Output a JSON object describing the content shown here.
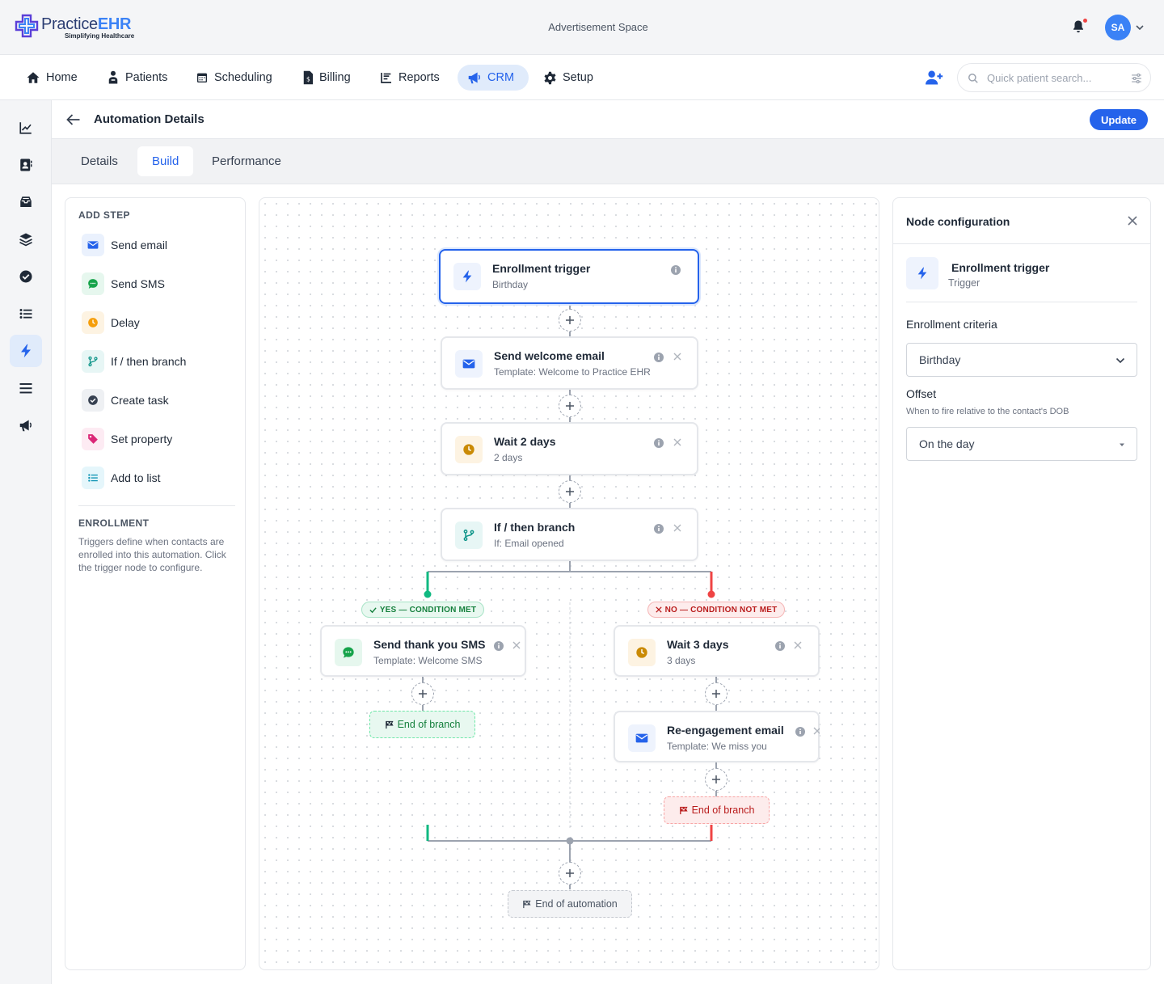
{
  "header": {
    "logo_main": "Practice",
    "logo_accent": "EHR",
    "logo_tagline": "Simplifying Healthcare",
    "ad_space": "Advertisement Space",
    "user_initials": "SA"
  },
  "nav": {
    "items": [
      {
        "label": "Home",
        "icon": "home-icon"
      },
      {
        "label": "Patients",
        "icon": "patient-icon"
      },
      {
        "label": "Scheduling",
        "icon": "calendar-icon"
      },
      {
        "label": "Billing",
        "icon": "billing-icon"
      },
      {
        "label": "Reports",
        "icon": "reports-icon"
      },
      {
        "label": "CRM",
        "icon": "megaphone-icon",
        "active": true
      },
      {
        "label": "Setup",
        "icon": "gear-icon"
      }
    ],
    "search_placeholder": "Quick patient search..."
  },
  "rail": {
    "icons": [
      "chart-line-icon",
      "contacts-icon",
      "inbox-icon",
      "layers-icon",
      "check-circle-icon",
      "list-icon",
      "bolt-icon",
      "menu-lines-icon",
      "megaphone-icon"
    ],
    "active_index": 6
  },
  "page": {
    "title": "Automation Details",
    "update_label": "Update",
    "tabs": [
      {
        "label": "Details"
      },
      {
        "label": "Build",
        "active": true
      },
      {
        "label": "Performance"
      }
    ]
  },
  "add_step": {
    "title": "ADD STEP",
    "items": [
      {
        "label": "Send email",
        "icon": "mail-icon"
      },
      {
        "label": "Send SMS",
        "icon": "sms-icon"
      },
      {
        "label": "Delay",
        "icon": "clock-icon"
      },
      {
        "label": "If / then branch",
        "icon": "branch-icon"
      },
      {
        "label": "Create task",
        "icon": "check-circle-icon"
      },
      {
        "label": "Set property",
        "icon": "tag-icon"
      },
      {
        "label": "Add to list",
        "icon": "list-icon"
      }
    ],
    "enrollment_title": "ENROLLMENT",
    "enrollment_text": "Triggers define when contacts are enrolled into this automation. Click the trigger node to configure."
  },
  "flow": {
    "trigger": {
      "title": "Enrollment trigger",
      "subtitle": "Birthday"
    },
    "welcome": {
      "title": "Send welcome email",
      "subtitle": "Template: Welcome to Practice EHR"
    },
    "wait2": {
      "title": "Wait 2 days",
      "subtitle": "2 days"
    },
    "branch": {
      "title": "If / then branch",
      "subtitle": "If: Email opened"
    },
    "yes_label": "YES — CONDITION MET",
    "no_label": "NO — CONDITION NOT MET",
    "thank_sms": {
      "title": "Send thank you SMS",
      "subtitle": "Template: Welcome SMS"
    },
    "wait3": {
      "title": "Wait 3 days",
      "subtitle": "3 days"
    },
    "reengage": {
      "title": "Re-engagement email",
      "subtitle": "Template: We miss you"
    },
    "end_branch_label": "End of branch",
    "end_automation_label": "End of automation",
    "colors": {
      "yes": "#10b981",
      "no": "#ef4444",
      "connector": "#9ca3af",
      "primary": "#2563eb"
    }
  },
  "config": {
    "title": "Node configuration",
    "node_title": "Enrollment trigger",
    "node_subtitle": "Trigger",
    "criteria_label": "Enrollment criteria",
    "criteria_value": "Birthday",
    "offset_label": "Offset",
    "offset_help": "When to fire relative to the contact's DOB",
    "offset_value": "On the day"
  }
}
